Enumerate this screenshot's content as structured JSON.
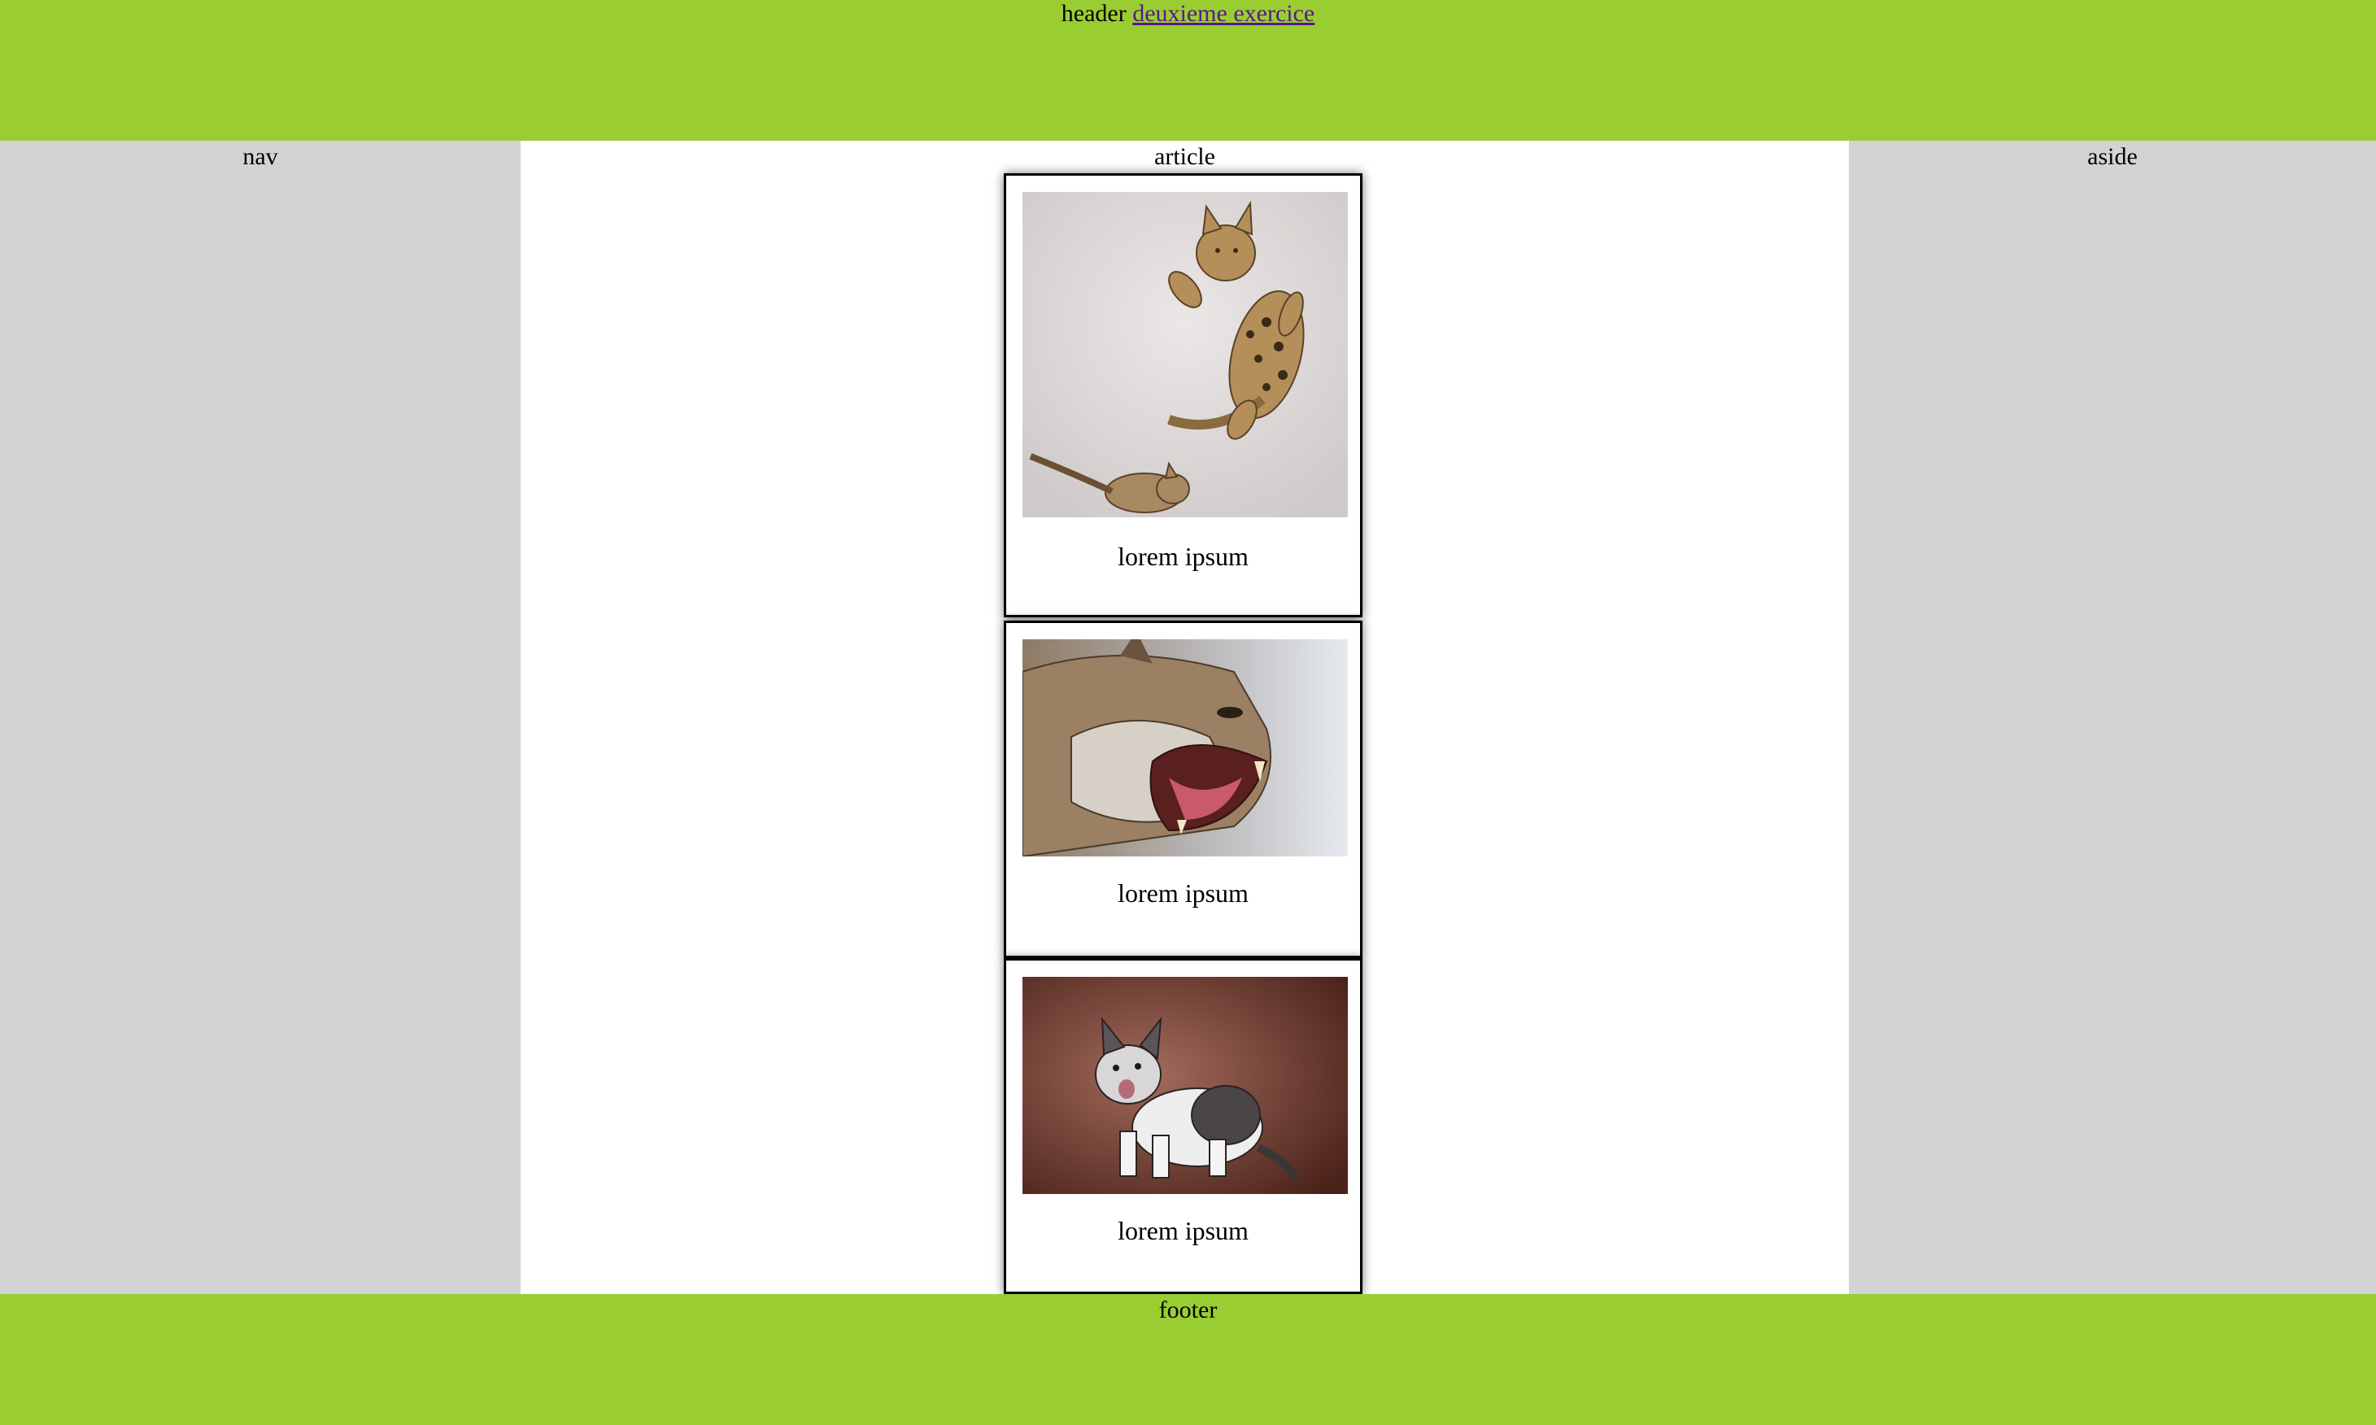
{
  "header": {
    "label": "header",
    "link_text": "deuxieme exercice"
  },
  "nav": {
    "label": "nav"
  },
  "article": {
    "label": "article",
    "cards": [
      {
        "caption": "lorem ipsum",
        "image": "leaping-bengal-cats-photo"
      },
      {
        "caption": "lorem ipsum",
        "image": "snarling-lynx-photo"
      },
      {
        "caption": "lorem ipsum",
        "image": "meowing-kitten-photo"
      }
    ]
  },
  "aside": {
    "label": "aside"
  },
  "footer": {
    "label": "footer"
  },
  "colors": {
    "header_footer_bg": "#9acd32",
    "sidebar_bg": "#d3d3d3",
    "article_bg": "#ffffff",
    "link": "#551a8b"
  }
}
